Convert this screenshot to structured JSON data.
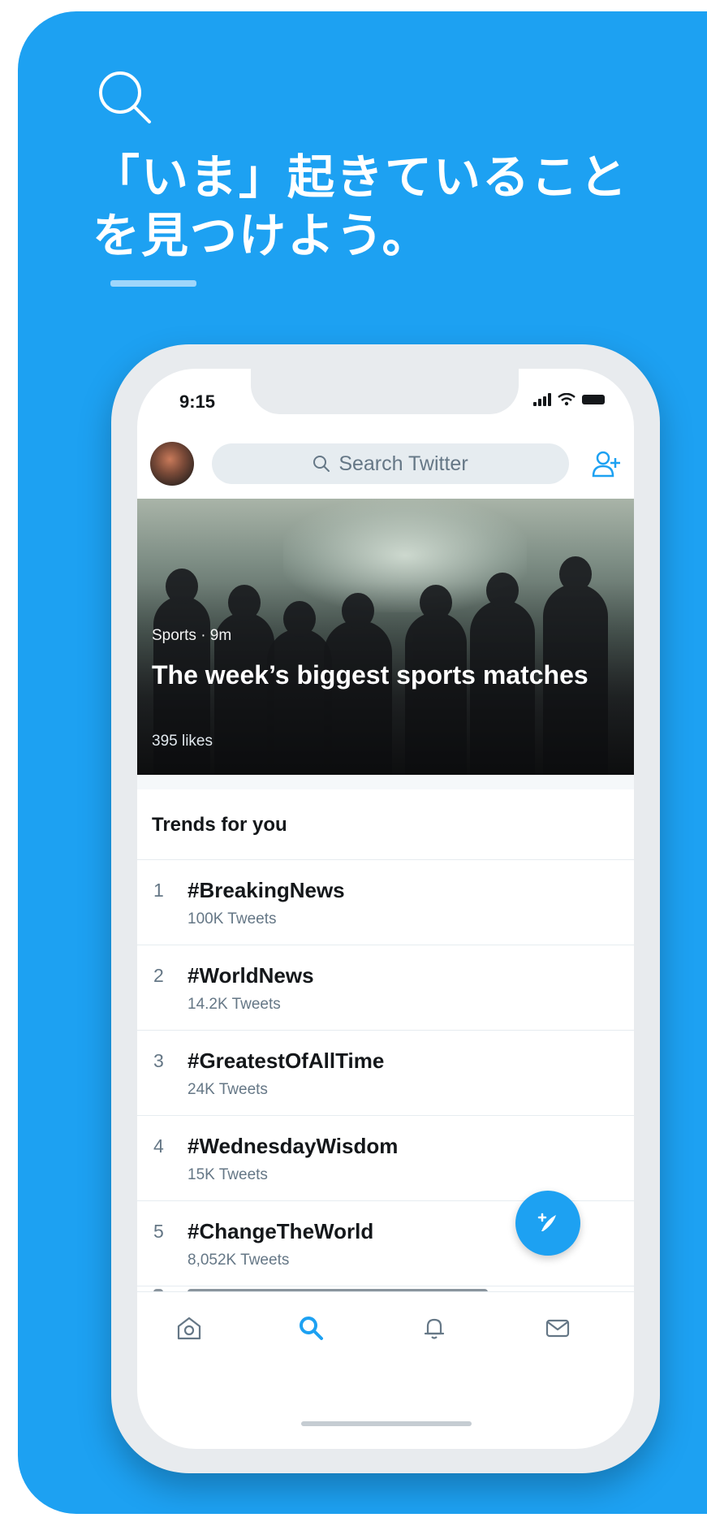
{
  "banner": {
    "headline": "「いま」起きていること を見つけよう。",
    "icon": "search-icon",
    "background_color": "#1da1f2"
  },
  "status_bar": {
    "time": "9:15"
  },
  "search": {
    "placeholder": "Search Twitter"
  },
  "hero": {
    "meta": "Sports · 9m",
    "title": "The week’s biggest sports matches",
    "likes": "395 likes"
  },
  "trends": {
    "heading": "Trends for you",
    "items": [
      {
        "rank": "1",
        "name": "#BreakingNews",
        "count": "100K Tweets"
      },
      {
        "rank": "2",
        "name": "#WorldNews",
        "count": "14.2K Tweets"
      },
      {
        "rank": "3",
        "name": "#GreatestOfAllTime",
        "count": "24K Tweets"
      },
      {
        "rank": "4",
        "name": "#WednesdayWisdom",
        "count": "15K Tweets"
      },
      {
        "rank": "5",
        "name": "#ChangeTheWorld",
        "count": "8,052K Tweets"
      }
    ]
  },
  "tabbar": {
    "items": [
      "home-icon",
      "search-icon",
      "bell-icon",
      "mail-icon"
    ],
    "active": "search-icon",
    "active_color": "#1da1f2",
    "inactive_color": "#657786"
  },
  "compose": {
    "icon": "compose-tweet-icon"
  }
}
